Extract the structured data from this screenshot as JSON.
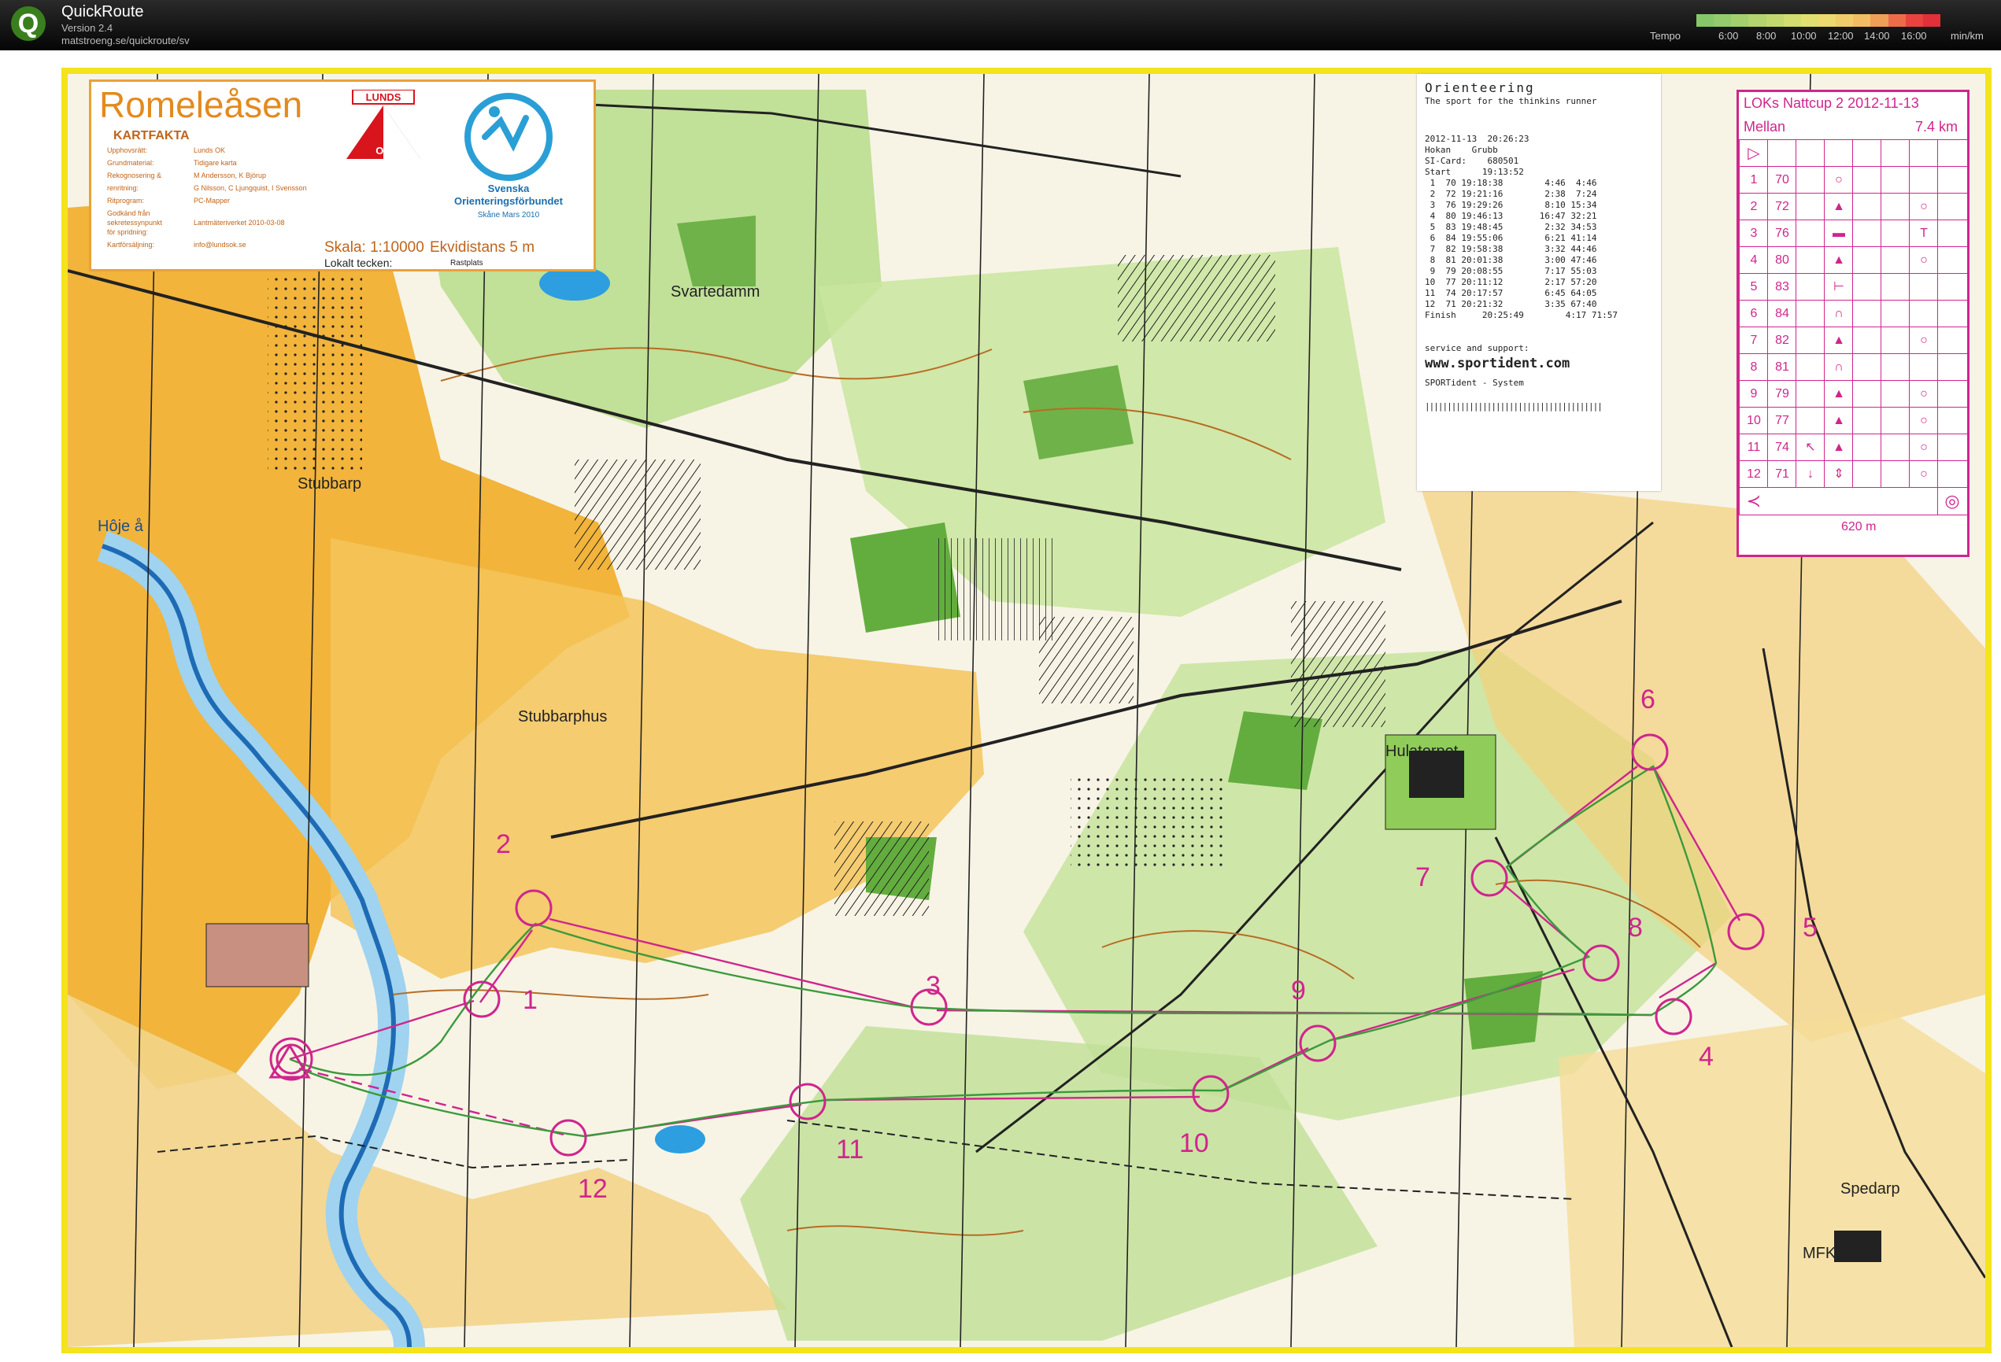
{
  "app": {
    "title": "QuickRoute",
    "version": "Version 2.4",
    "url": "matstroeng.se/quickroute/sv",
    "tempo_label": "Tempo",
    "tempo_ticks": [
      "6:00",
      "8:00",
      "10:00",
      "12:00",
      "14:00",
      "16:00"
    ],
    "unit_label": "min/km",
    "tempo_colors": [
      "#86c76a",
      "#94cb6c",
      "#a3cf6d",
      "#b3d46e",
      "#c2d86f",
      "#d2dc70",
      "#e0de71",
      "#ecd96f",
      "#f1cc6a",
      "#f1bd64",
      "#ef9f58",
      "#ec6c4a",
      "#e9433f",
      "#e0303a"
    ]
  },
  "map": {
    "title": "Romeleåsen",
    "kartfakta_heading": "KARTFAKTA",
    "kartfakta": [
      {
        "k": "Upphovsrätt:",
        "v": "Lunds OK"
      },
      {
        "k": "Grundmaterial:",
        "v": "Tidigare karta"
      },
      {
        "k": "Rekognosering &",
        "v": "M Andersson, K Björup"
      },
      {
        "k": "renritning:",
        "v": "G Nilsson, C Ljungquist, I Svensson"
      },
      {
        "k": "Ritprogram:",
        "v": "PC-Mapper"
      },
      {
        "k": "Godkänd från",
        "v": ""
      },
      {
        "k": "sekretessynpunkt",
        "v": "Lantmäteriverket 2010-03-08"
      },
      {
        "k": "för spridning:",
        "v": ""
      },
      {
        "k": "Kartförsäljning:",
        "v": "info@lundsok.se"
      }
    ],
    "scale": "Skala: 1:10000",
    "equidistance": "Ekvidistans 5 m",
    "local_symbols": "Lokalt tecken:",
    "rest_symbol": "Rastplats",
    "lunds_logo_top": "LUNDS",
    "lunds_logo_bottom": "OK",
    "sof_line1": "Svenska",
    "sof_line2": "Orienteringsförbundet",
    "sof_line3": "Skåne Mars 2010",
    "places": [
      {
        "name": "Svartedamm",
        "id": "svartedamm"
      },
      {
        "name": "Stubbarp",
        "id": "stubbarp"
      },
      {
        "name": "Stubbarphus",
        "id": "stubbarphus"
      },
      {
        "name": "Hôje å",
        "id": "hoje"
      },
      {
        "name": "Hulatorpet",
        "id": "hulatorpet"
      },
      {
        "name": "Spedarp",
        "id": "spedarp"
      },
      {
        "name": "MFK",
        "id": "mfk"
      }
    ],
    "control_numbers": [
      "1",
      "2",
      "3",
      "4",
      "5",
      "6",
      "7",
      "8",
      "9",
      "10",
      "11",
      "12"
    ]
  },
  "receipt": {
    "heading": "Orienteering",
    "tagline": "The sport for the thinkins runner",
    "datetime": "2012-11-13  20:26:23",
    "name": "Hokan    Grubb",
    "sicard": "SI-Card:    680501",
    "start": "Start      19:13:52",
    "splits": [
      " 1  70 19:18:38        4:46  4:46",
      " 2  72 19:21:16        2:38  7:24",
      " 3  76 19:29:26        8:10 15:34",
      " 4  80 19:46:13       16:47 32:21",
      " 5  83 19:48:45        2:32 34:53",
      " 6  84 19:55:06        6:21 41:14",
      " 7  82 19:58:38        3:32 44:46",
      " 8  81 20:01:38        3:00 47:46",
      " 9  79 20:08:55        7:17 55:03",
      "10  77 20:11:12        2:17 57:20",
      "11  74 20:17:57        6:45 64:05",
      "12  71 20:21:32        3:35 67:40"
    ],
    "finish": "Finish     20:25:49        4:17 71:57",
    "service": "service and support:",
    "website": "www.sportident.com",
    "system": "SPORTident - System"
  },
  "description": {
    "title": "LOKs Nattcup 2 2012-11-13",
    "class": "Mellan",
    "length": "7.4 km",
    "rows": [
      {
        "n": "1",
        "code": "70"
      },
      {
        "n": "2",
        "code": "72"
      },
      {
        "n": "3",
        "code": "76"
      },
      {
        "n": "4",
        "code": "80"
      },
      {
        "n": "5",
        "code": "83"
      },
      {
        "n": "6",
        "code": "84"
      },
      {
        "n": "7",
        "code": "82"
      },
      {
        "n": "8",
        "code": "81"
      },
      {
        "n": "9",
        "code": "79"
      },
      {
        "n": "10",
        "code": "77"
      },
      {
        "n": "11",
        "code": "74"
      },
      {
        "n": "12",
        "code": "71"
      }
    ],
    "finish_distance": "620 m"
  }
}
